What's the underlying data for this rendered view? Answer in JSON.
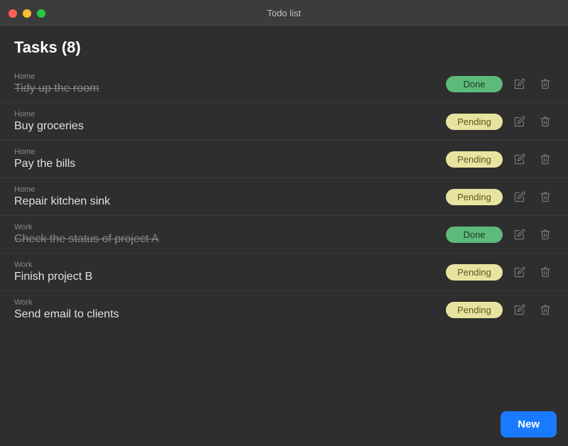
{
  "titleBar": {
    "title": "Todo list",
    "trafficLights": [
      "close",
      "minimize",
      "maximize"
    ]
  },
  "header": {
    "title": "Tasks (8)"
  },
  "tasks": [
    {
      "id": 1,
      "category": "Home",
      "name": "Tidy up the room",
      "status": "Done",
      "done": true
    },
    {
      "id": 2,
      "category": "Home",
      "name": "Buy groceries",
      "status": "Pending",
      "done": false
    },
    {
      "id": 3,
      "category": "Home",
      "name": "Pay the bills",
      "status": "Pending",
      "done": false
    },
    {
      "id": 4,
      "category": "Home",
      "name": "Repair kitchen sink",
      "status": "Pending",
      "done": false
    },
    {
      "id": 5,
      "category": "Work",
      "name": "Check the status of project A",
      "status": "Done",
      "done": true
    },
    {
      "id": 6,
      "category": "Work",
      "name": "Finish project B",
      "status": "Pending",
      "done": false
    },
    {
      "id": 7,
      "category": "Work",
      "name": "Send email to clients",
      "status": "Pending",
      "done": false
    }
  ],
  "buttons": {
    "new": "New"
  }
}
